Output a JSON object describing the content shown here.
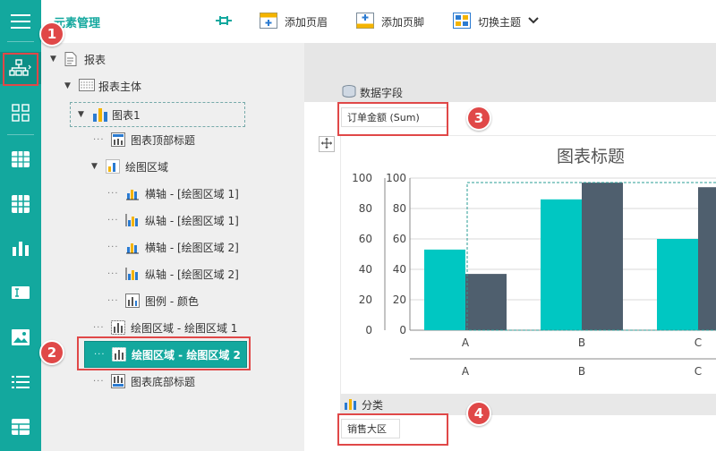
{
  "toolbar": {
    "title": "元素管理",
    "buttons": [
      {
        "label": ""
      },
      {
        "label": "添加页眉"
      },
      {
        "label": "添加页脚"
      },
      {
        "label": "切换主题"
      }
    ]
  },
  "tree": {
    "nodes": [
      {
        "label": "报表"
      },
      {
        "label": "报表主体"
      },
      {
        "label": "图表1"
      },
      {
        "label": "图表顶部标题"
      },
      {
        "label": "绘图区域"
      },
      {
        "label": "横轴 - [绘图区域 1]"
      },
      {
        "label": "纵轴 - [绘图区域 1]"
      },
      {
        "label": "横轴 - [绘图区域 2]"
      },
      {
        "label": "纵轴 - [绘图区域 2]"
      },
      {
        "label": "图例 - 颜色"
      },
      {
        "label": "绘图区域 - 绘图区域 1"
      },
      {
        "label": "绘图区域 - 绘图区域 2"
      },
      {
        "label": "图表底部标题"
      }
    ]
  },
  "canvas": {
    "data_field_label": "数据字段",
    "data_field_chip": "订单金额 (Sum)",
    "category_label": "分类",
    "category_chip": "销售大区"
  },
  "callouts": [
    "1",
    "2",
    "3",
    "4"
  ],
  "colors": {
    "accent": "#13a89e",
    "callout": "#e04848",
    "series1": "#00c7c2",
    "series2": "#4f5f6e"
  },
  "chart_data": {
    "type": "bar",
    "title": "图表标题",
    "categories": [
      "A",
      "B",
      "C"
    ],
    "series": [
      {
        "values": [
          53,
          86,
          60
        ]
      },
      {
        "values": [
          37,
          97,
          94
        ]
      }
    ],
    "ylim": [
      0,
      100
    ],
    "yticks": [
      0,
      20,
      40,
      60,
      80,
      100
    ],
    "grid": true
  }
}
